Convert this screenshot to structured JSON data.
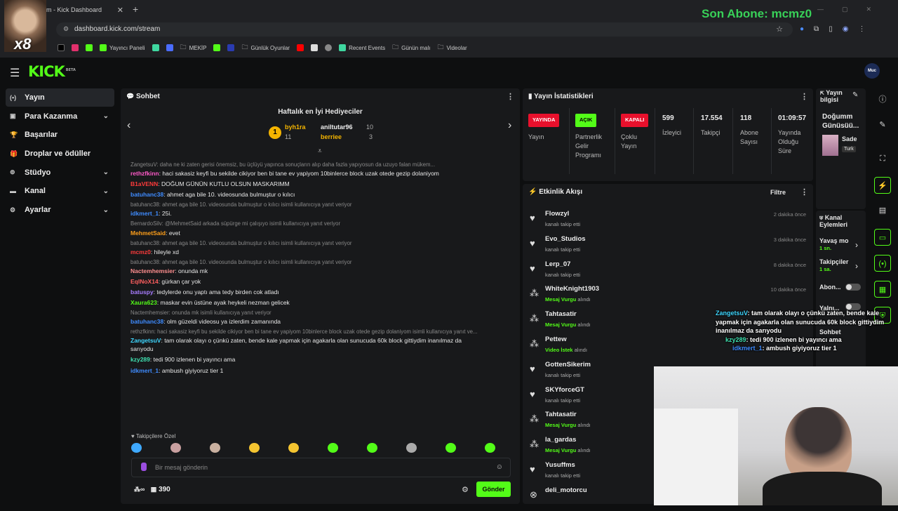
{
  "browser": {
    "tab_title": "m - Kick Dashboard",
    "url": "dashboard.kick.com/stream",
    "bookmarks": [
      "Yayıncı Paneli",
      "MEKİP",
      "Günlük Oyunlar",
      "Recent Events",
      "Günün malı",
      "Videolar"
    ],
    "streamer_label": "x8"
  },
  "overlay": {
    "last_sub": "Son Abone: mcmz0"
  },
  "header": {
    "logo": "KICK",
    "logo_badge": "BETA",
    "avatar_text": "Muc"
  },
  "sidebar": {
    "items": [
      {
        "label": "Yayın",
        "icon": "broadcast-icon"
      },
      {
        "label": "Para Kazanma",
        "icon": "money-icon"
      },
      {
        "label": "Başarılar",
        "icon": "trophy-icon"
      },
      {
        "label": "Droplar ve ödüller",
        "icon": "gift-icon"
      },
      {
        "label": "Stüdyo",
        "icon": "studio-icon"
      },
      {
        "label": "Kanal",
        "icon": "channel-icon"
      },
      {
        "label": "Ayarlar",
        "icon": "gear-icon"
      }
    ]
  },
  "chat": {
    "title": "Sohbet",
    "gifters_title": "Haftalık en İyi Hediyeciler",
    "gifters": [
      {
        "name": "byh1ra",
        "count": "11",
        "color": "#f4b400"
      },
      {
        "name": "aniltutar96",
        "count": "10",
        "color": "#e8e8e8"
      },
      {
        "name": "berriee",
        "count": "3",
        "color": "#f4b400"
      }
    ],
    "messages": [
      {
        "reply": "ZangetsuV: daha ne ki zaten gerisi önemsiz, bu üçlüyü yapınca sonuçların alıp daha fazla yapıyosun da uzuyo falan mükem...",
        "user": "rethzfkinn",
        "color": "#ff5ac8",
        "text": "haci sakasiz keyfi bu sekilde cikiyor ben bi tane ev yapiyom 10binlerce block uzak otede gezip dolaniyom"
      },
      {
        "user": "B1aVENN",
        "color": "#ff3b3b",
        "text": "DOĞUM GÜNÜN KUTLU OLSUN MASKARIMM"
      },
      {
        "user": "batuhanc38",
        "color": "#3f8cff",
        "text": "ahmet aga bile 10. videosunda bulmuştur o kılıcı"
      },
      {
        "reply": "batuhanc38: ahmet aga bile 10. videosunda bulmuştur o kılıcı isimli kullanıcıya yanıt veriyor",
        "user": "idkmert_1",
        "color": "#3f8cff",
        "text": "25i."
      },
      {
        "reply": "BernardoSilv: @MehmetSaid arkada süpürge mi çalışıyo isimli kullanıcıya yanıt veriyor",
        "user": "MehmetSaid",
        "color": "#ff9f1a",
        "text": "evet"
      },
      {
        "reply": "batuhanc38: ahmet aga bile 10. videosunda bulmuştur o kılıcı isimli kullanıcıya yanıt veriyor",
        "user": "mcmz0",
        "color": "#ff3b3b",
        "text": "hileyle xd"
      },
      {
        "reply": "batuhanc38: ahmet aga bile 10. videosunda bulmuştur o kılıcı isimli kullanıcıya yanıt veriyor",
        "user": "Nactemhemsier",
        "color": "#ff8f8f",
        "text": "onunda mk"
      },
      {
        "user": "EqlNoX14",
        "color": "#ff5f5f",
        "text": "gürkan çar yok"
      },
      {
        "user": "batuspy",
        "color": "#a87cff",
        "text": "tedylerde onu yaptı ama tedy birden cok atladı"
      },
      {
        "user": "Xaura623",
        "color": "#53fc18",
        "text": "maskar evin üstüne ayak heykeli nezman gelicek"
      },
      {
        "reply": "Nactemhemsier: onunda mk isimli kullanıcıya yanıt veriyor",
        "user": "batuhanc38",
        "color": "#3f8cff",
        "text": "olm güzeldi videosu ya izlerdim zamanında"
      },
      {
        "reply": "rethzfkinn: haci sakasiz keyfi bu sekilde cikiyor ben bi tane ev yapiyom 10binlerce block uzak otede gezip dolaniyom isimli kullanıcıya yanıt ve...",
        "user": "ZangetsuV",
        "color": "#3fd7ff",
        "text": "tam olarak olayı o çünkü zaten, bende kale yapmak için agakarla olan sunucuda 60k block gittiydim  inanılmaz da",
        "text2": "sarıyodu"
      },
      {
        "user": "kzy289",
        "color": "#3fe0b0",
        "text": "tedi 900 izlenen bi yayıncı ama"
      },
      {
        "user": "idkmert_1",
        "color": "#3f8cff",
        "text": "ambush giyiyoruz tier 1"
      }
    ],
    "followers_label": "Takipçilere Özel",
    "input_placeholder": "Bir mesaj gönderin",
    "points": "390",
    "send_label": "Gönder"
  },
  "stats": {
    "title": "Yayın İstatistikleri",
    "items": [
      {
        "pill": "YAYINDA",
        "pill_color": "#e8102c",
        "label": "Yayın"
      },
      {
        "pill": "AÇIK",
        "pill_color": "#53fc18",
        "label": "Partnerlik Gelir Programı"
      },
      {
        "pill": "KAPALI",
        "pill_color": "#e8102c",
        "label": "Çoklu Yayın"
      },
      {
        "value": "599",
        "label": "İzleyici"
      },
      {
        "value": "17.554",
        "label": "Takipçi"
      },
      {
        "value": "118",
        "label": "Abone Sayısı"
      },
      {
        "value": "01:09:57",
        "label": "Yayında Olduğu Süre"
      }
    ]
  },
  "stream_info": {
    "title": "Yayın bilgisi",
    "stream_title": "Doğumm Günüsüü...",
    "category": "Sade",
    "tag": "Turk"
  },
  "activity": {
    "title": "Etkinlik Akışı",
    "filter_label": "Filtre",
    "items": [
      {
        "user": "Flowzyl",
        "sub": "kanalı takip etti",
        "time": "2 dakika önce",
        "icon": "heart-icon"
      },
      {
        "user": "Evo_Studios",
        "sub": "kanalı takip etti",
        "time": "3 dakika önce",
        "icon": "heart-icon"
      },
      {
        "user": "Lerp_07",
        "sub": "kanalı takip etti",
        "time": "8 dakika önce",
        "icon": "heart-icon"
      },
      {
        "user": "WhiteKnight1903",
        "sub_hl": "Mesaj Vurgu",
        "sub": "alındı",
        "time": "10 dakika önce",
        "icon": "points-icon"
      },
      {
        "user": "Tahtasatir",
        "sub_hl": "Mesaj Vurgu",
        "sub": "alındı",
        "time": "",
        "icon": "points-icon"
      },
      {
        "user": "Pettew",
        "sub_hl": "Video İstek",
        "sub": "alındı",
        "time": "",
        "icon": "points-icon"
      },
      {
        "user": "GottenSikerim",
        "sub": "kanalı takip etti",
        "time": "",
        "icon": "heart-icon"
      },
      {
        "user": "SKYforceGT",
        "sub": "kanalı takip etti",
        "time": "",
        "icon": "heart-icon"
      },
      {
        "user": "Tahtasatir",
        "sub_hl": "Mesaj Vurgu",
        "sub": "alındı",
        "time": "",
        "icon": "points-icon"
      },
      {
        "user": "la_gardas",
        "sub_hl": "Mesaj Vurgu",
        "sub": "alındı",
        "time": "",
        "icon": "points-icon"
      },
      {
        "user": "Yusuffms",
        "sub": "kanalı takip etti",
        "time": "",
        "icon": "heart-icon"
      },
      {
        "user": "deli_motorcu",
        "sub": "",
        "time": "",
        "icon": "close-circle-icon"
      }
    ]
  },
  "channel_actions": {
    "title": "Kanal Eylemleri",
    "items": [
      {
        "label": "Yavaş mo",
        "value": "1 sn."
      },
      {
        "label": "Takipçiler",
        "value": "1 sa."
      },
      {
        "label": "Abon..."
      },
      {
        "label": "Yalnı..."
      }
    ],
    "extra": "Sohbet"
  },
  "overlay_chat": [
    {
      "user": "ZangetsuV",
      "color": "#3fd7ff",
      "text": "tam olarak olayı o çünkü zaten, bende kale yapmak için agakarla olan sunucuda 60k block gittiydim inanılmaz da sarıyodu"
    },
    {
      "user": "kzy289",
      "color": "#3fe0b0",
      "text": "tedi 900 izlenen bi yayıncı ama"
    },
    {
      "user": "idkmert_1",
      "color": "#3f8cff",
      "text": "ambush giyiyoruz tier 1"
    }
  ]
}
